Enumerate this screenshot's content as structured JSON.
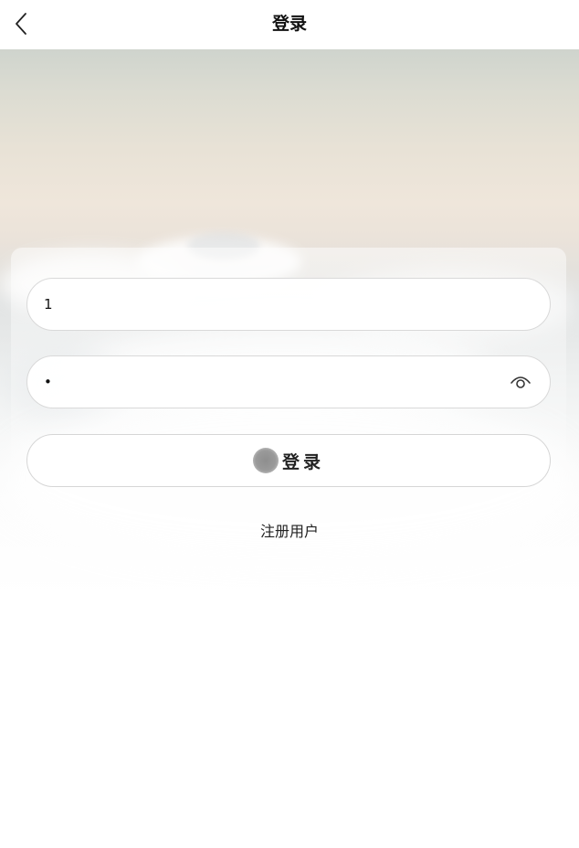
{
  "nav": {
    "title": "登录",
    "back_icon": "chevron-left-icon"
  },
  "form": {
    "username_value": "1",
    "password_value": "1",
    "password_toggle_icon": "eye-icon",
    "login_label": "登录",
    "loading_indicator": "spinner-icon",
    "register_link": "注册用户"
  },
  "colors": {
    "background": "#ffffff",
    "field_border": "#d9d9d9",
    "text": "#111111",
    "spinner": "#9a9a9a"
  }
}
